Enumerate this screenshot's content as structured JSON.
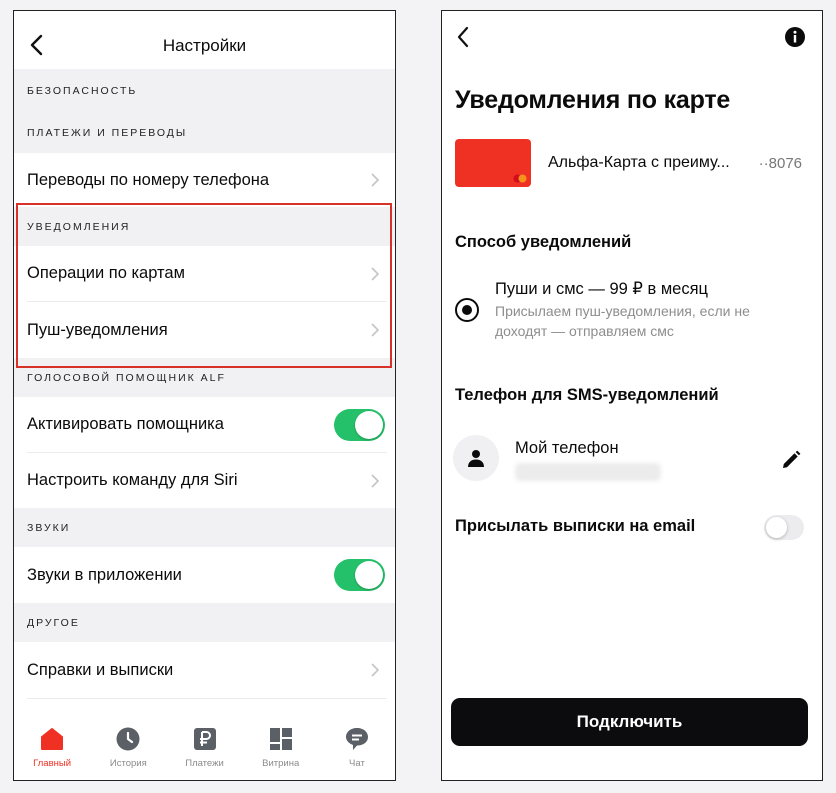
{
  "colors": {
    "accent_red": "#EF3124",
    "toggle_green": "#25C16A",
    "highlight_border": "#D8312A",
    "button_black": "#0C0C0E"
  },
  "left": {
    "header": {
      "title": "Настройки",
      "back_icon": "chevron-left-icon"
    },
    "sections": {
      "security": "Безопасность",
      "payments": "Платежи и переводы",
      "notifications": "Уведомления",
      "voice": "Голосовой помощник ALF",
      "sounds": "Звуки",
      "other": "Другое"
    },
    "rows": {
      "phone_transfers": "Переводы по номеру телефона",
      "card_operations": "Операции по картам",
      "push_notifications": "Пуш-уведомления",
      "activate_assistant": "Активировать помощника",
      "siri_command": "Настроить команду для Siri",
      "app_sounds": "Звуки в приложении",
      "statements": "Справки и выписки"
    },
    "toggles": {
      "activate_assistant": true,
      "app_sounds": true
    },
    "tabbar": [
      {
        "label": "Главный",
        "icon": "home-icon",
        "active": true
      },
      {
        "label": "История",
        "icon": "clock-icon",
        "active": false
      },
      {
        "label": "Платежи",
        "icon": "ruble-icon",
        "active": false
      },
      {
        "label": "Витрина",
        "icon": "grid-icon",
        "active": false
      },
      {
        "label": "Чат",
        "icon": "chat-icon",
        "active": false
      }
    ]
  },
  "right": {
    "title": "Уведомления по карте",
    "card": {
      "name": "Альфа-Карта с преиму...",
      "number": "··8076"
    },
    "method_heading": "Способ уведомлений",
    "option": {
      "title": "Пуши и смс — 99 ₽ в месяц",
      "description": "Присылаем пуш-уведомления, если не доходят — отправляем смс",
      "selected": true
    },
    "sms_heading": "Телефон для SMS-уведомлений",
    "phone_label": "Мой телефон",
    "email_label": "Присылать выписки на email",
    "email_toggle": false,
    "connect_button": "Подключить"
  }
}
